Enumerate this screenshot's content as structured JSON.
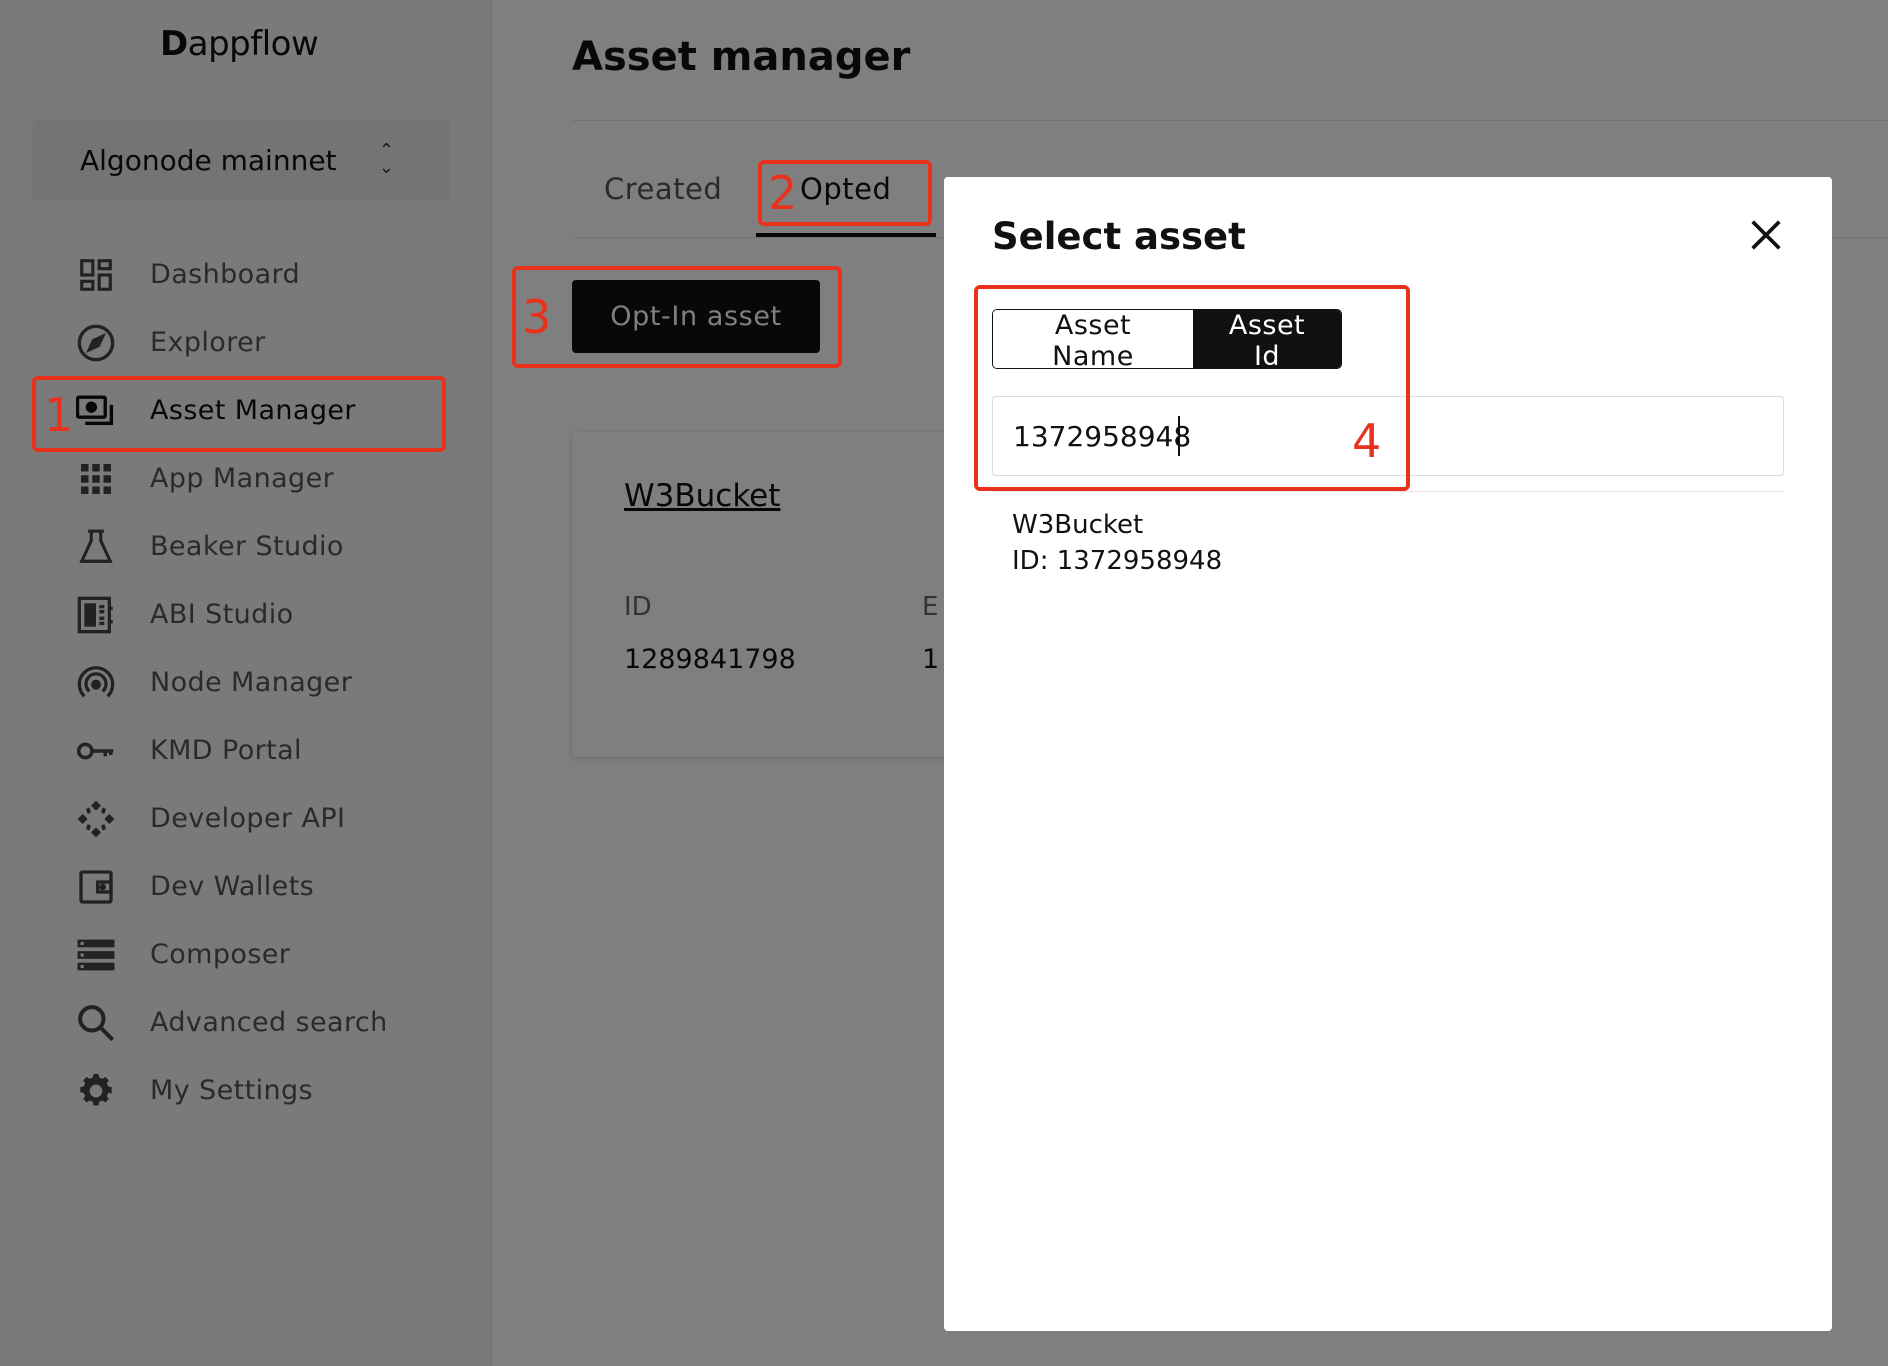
{
  "sidebar": {
    "logo_mark": "D",
    "logo_text": "appflow",
    "network": "Algonode mainnet",
    "items": [
      {
        "label": "Dashboard",
        "icon": "dashboard-icon"
      },
      {
        "label": "Explorer",
        "icon": "compass-icon"
      },
      {
        "label": "Asset Manager",
        "icon": "cash-icon"
      },
      {
        "label": "App Manager",
        "icon": "apps-grid-icon"
      },
      {
        "label": "Beaker Studio",
        "icon": "beaker-icon"
      },
      {
        "label": "ABI Studio",
        "icon": "abi-icon"
      },
      {
        "label": "Node Manager",
        "icon": "broadcast-icon"
      },
      {
        "label": "KMD Portal",
        "icon": "key-icon"
      },
      {
        "label": "Developer API",
        "icon": "api-icon"
      },
      {
        "label": "Dev Wallets",
        "icon": "wallet-icon"
      },
      {
        "label": "Composer",
        "icon": "composer-icon"
      },
      {
        "label": "Advanced search",
        "icon": "search-icon"
      },
      {
        "label": "My Settings",
        "icon": "gear-icon"
      }
    ]
  },
  "main": {
    "title": "Asset manager",
    "tabs": [
      {
        "label": "Created"
      },
      {
        "label": "Opted"
      }
    ],
    "optin_button": "Opt-In asset",
    "card": {
      "name": "W3Bucket",
      "id_label": "ID",
      "id_value": "1289841798",
      "col2_label": "E",
      "col2_value": "1"
    }
  },
  "modal": {
    "title": "Select asset",
    "toggle": {
      "name_label": "Asset Name",
      "id_label": "Asset Id"
    },
    "search_value": "1372958948",
    "result": {
      "name": "W3Bucket",
      "id_line": "ID: 1372958948"
    }
  },
  "annotations": {
    "color": "#e8321e",
    "labels": [
      "1",
      "2",
      "3",
      "4"
    ]
  }
}
